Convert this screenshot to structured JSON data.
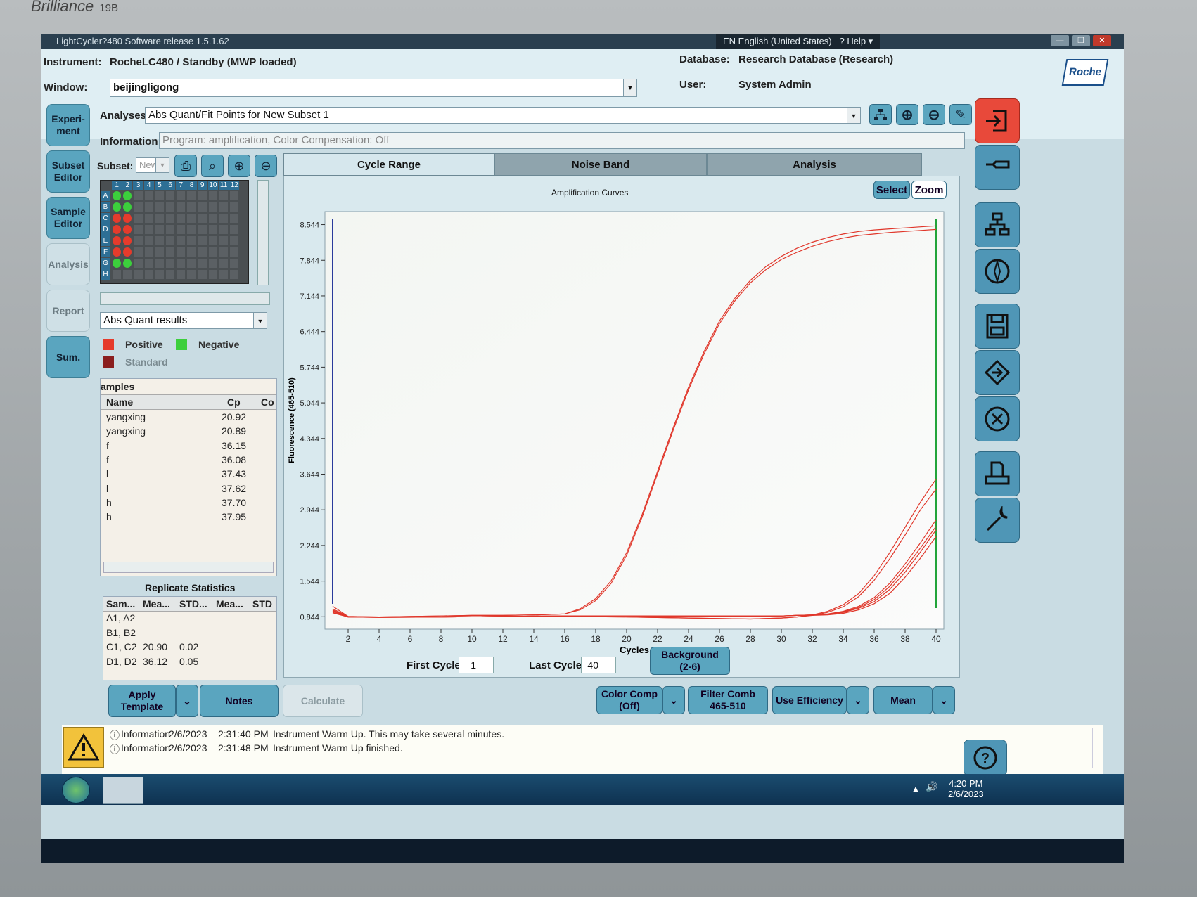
{
  "monitor": {
    "brand": "Brilliance",
    "model": "19B"
  },
  "app": {
    "title": "LightCycler?480 Software release 1.5.1.62",
    "language": "EN English (United States)",
    "help_label": "Help"
  },
  "header": {
    "instrument_label": "Instrument:",
    "instrument_value": "RocheLC480 / Standby (MWP loaded)",
    "window_label": "Window:",
    "window_value": "beijingligong",
    "database_label": "Database:",
    "database_value": "Research Database (Research)",
    "user_label": "User:",
    "user_value": "System Admin",
    "logo": "Roche"
  },
  "left_nav": [
    {
      "label": "Experi-\nment",
      "state": "active"
    },
    {
      "label": "Subset\nEditor",
      "state": "active"
    },
    {
      "label": "Sample\nEditor",
      "state": "active"
    },
    {
      "label": "Analysis",
      "state": "disabled"
    },
    {
      "label": "Report",
      "state": "disabled"
    },
    {
      "label": "Sum.",
      "state": "active"
    }
  ],
  "analyses": {
    "label": "Analyses",
    "value": "Abs Quant/Fit Points for New Subset 1",
    "info_label": "Information",
    "info_value": "Program: amplification, Color Compensation: Off"
  },
  "subset": {
    "label": "Subset:",
    "value": "New",
    "columns": [
      "1",
      "2",
      "3",
      "4",
      "5",
      "6",
      "7",
      "8",
      "9",
      "10",
      "11",
      "12"
    ],
    "rows": [
      "A",
      "B",
      "C",
      "D",
      "E",
      "F",
      "G",
      "H"
    ],
    "wells": {
      "A": [
        "green",
        "green"
      ],
      "B": [
        "green",
        "green"
      ],
      "C": [
        "red",
        "red"
      ],
      "D": [
        "red",
        "red"
      ],
      "E": [
        "red",
        "red"
      ],
      "F": [
        "red",
        "red"
      ],
      "G": [
        "green",
        "green"
      ]
    }
  },
  "results_combo": "Abs Quant results",
  "legend": {
    "positive": "Positive",
    "negative": "Negative",
    "standard": "Standard"
  },
  "colors": {
    "positive": "#e53b2c",
    "negative": "#3ccf3c",
    "standard": "#8a1e1e",
    "curve": "#e0362a",
    "threshold_left": "#2a3b9c",
    "threshold_right": "#22a43a"
  },
  "samples_table": {
    "title": "amples",
    "headers": [
      "Name",
      "Cp",
      "Co"
    ],
    "rows": [
      {
        "name": "yangxing",
        "cp": "20.92"
      },
      {
        "name": "yangxing",
        "cp": "20.89"
      },
      {
        "name": "f",
        "cp": "36.15"
      },
      {
        "name": "f",
        "cp": "36.08"
      },
      {
        "name": "l",
        "cp": "37.43"
      },
      {
        "name": "l",
        "cp": "37.62"
      },
      {
        "name": "h",
        "cp": "37.70"
      },
      {
        "name": "h",
        "cp": "37.95"
      }
    ]
  },
  "replicate_stats": {
    "title": "Replicate Statistics",
    "headers": [
      "Sam...",
      "Mea...",
      "STD...",
      "Mea...",
      "STD"
    ],
    "rows": [
      {
        "sample": "A1, A2",
        "mean": "",
        "std": ""
      },
      {
        "sample": "B1, B2",
        "mean": "",
        "std": ""
      },
      {
        "sample": "C1, C2",
        "mean": "20.90",
        "std": "0.02"
      },
      {
        "sample": "D1, D2",
        "mean": "36.12",
        "std": "0.05"
      }
    ]
  },
  "tabs": [
    "Cycle Range",
    "Noise Band",
    "Analysis"
  ],
  "chart_buttons": {
    "select": "Select",
    "zoom": "Zoom"
  },
  "chart_data": {
    "type": "line",
    "title": "Amplification Curves",
    "xlabel": "Cycles",
    "ylabel": "Fluorescence (465-510)",
    "xlim": [
      0.5,
      40.5
    ],
    "ylim": [
      0.6,
      8.8
    ],
    "xticks": [
      2,
      4,
      6,
      8,
      10,
      12,
      14,
      16,
      18,
      20,
      22,
      24,
      26,
      28,
      30,
      32,
      34,
      36,
      38,
      40
    ],
    "yticks": [
      "0.844",
      "1.544",
      "2.244",
      "2.944",
      "3.644",
      "4.344",
      "5.044",
      "5.744",
      "6.444",
      "7.144",
      "7.844",
      "8.544"
    ],
    "threshold_lines": {
      "left_x": 1,
      "right_x": 40
    },
    "series": [
      {
        "x": [
          1,
          2,
          4,
          6,
          8,
          10,
          12,
          14,
          16,
          17,
          18,
          19,
          20,
          21,
          22,
          23,
          24,
          25,
          26,
          27,
          28,
          29,
          30,
          31,
          32,
          33,
          34,
          35,
          36,
          37,
          38,
          39,
          40
        ],
        "values": [
          1.05,
          0.85,
          0.84,
          0.85,
          0.86,
          0.87,
          0.87,
          0.88,
          0.9,
          1.0,
          1.2,
          1.55,
          2.1,
          2.85,
          3.7,
          4.55,
          5.35,
          6.05,
          6.65,
          7.1,
          7.45,
          7.72,
          7.92,
          8.08,
          8.2,
          8.29,
          8.36,
          8.41,
          8.44,
          8.46,
          8.48,
          8.5,
          8.52
        ]
      },
      {
        "x": [
          1,
          2,
          4,
          6,
          8,
          10,
          12,
          14,
          16,
          17,
          18,
          19,
          20,
          21,
          22,
          23,
          24,
          25,
          26,
          27,
          28,
          29,
          30,
          31,
          32,
          33,
          34,
          35,
          36,
          37,
          38,
          39,
          40
        ],
        "values": [
          1.0,
          0.85,
          0.84,
          0.85,
          0.86,
          0.87,
          0.87,
          0.88,
          0.9,
          0.98,
          1.16,
          1.5,
          2.05,
          2.8,
          3.65,
          4.5,
          5.3,
          6.0,
          6.6,
          7.05,
          7.4,
          7.66,
          7.86,
          8.0,
          8.12,
          8.21,
          8.28,
          8.33,
          8.36,
          8.39,
          8.41,
          8.43,
          8.45
        ]
      },
      {
        "x": [
          1,
          2,
          4,
          8,
          12,
          16,
          20,
          24,
          28,
          30,
          31,
          32,
          33,
          34,
          35,
          36,
          37,
          38,
          39,
          40
        ],
        "values": [
          0.95,
          0.84,
          0.83,
          0.84,
          0.85,
          0.85,
          0.84,
          0.82,
          0.8,
          0.82,
          0.84,
          0.88,
          0.95,
          1.08,
          1.3,
          1.65,
          2.1,
          2.6,
          3.1,
          3.55
        ]
      },
      {
        "x": [
          1,
          2,
          4,
          8,
          12,
          16,
          20,
          24,
          28,
          30,
          31,
          32,
          33,
          34,
          35,
          36,
          37,
          38,
          39,
          40
        ],
        "values": [
          0.98,
          0.84,
          0.83,
          0.84,
          0.85,
          0.85,
          0.84,
          0.82,
          0.8,
          0.82,
          0.84,
          0.87,
          0.93,
          1.04,
          1.24,
          1.56,
          1.98,
          2.45,
          2.95,
          3.35
        ]
      },
      {
        "x": [
          1,
          2,
          4,
          8,
          12,
          16,
          20,
          24,
          28,
          30,
          31,
          32,
          33,
          34,
          35,
          36,
          37,
          38,
          39,
          40
        ],
        "values": [
          0.92,
          0.84,
          0.84,
          0.84,
          0.85,
          0.86,
          0.86,
          0.85,
          0.85,
          0.86,
          0.87,
          0.88,
          0.9,
          0.95,
          1.05,
          1.22,
          1.5,
          1.88,
          2.3,
          2.75
        ]
      },
      {
        "x": [
          1,
          2,
          4,
          8,
          12,
          16,
          20,
          24,
          28,
          30,
          31,
          32,
          33,
          34,
          35,
          36,
          37,
          38,
          39,
          40
        ],
        "values": [
          0.93,
          0.84,
          0.84,
          0.84,
          0.85,
          0.86,
          0.86,
          0.85,
          0.85,
          0.86,
          0.87,
          0.88,
          0.9,
          0.94,
          1.03,
          1.18,
          1.44,
          1.8,
          2.2,
          2.62
        ]
      },
      {
        "x": [
          1,
          2,
          4,
          8,
          12,
          16,
          20,
          24,
          28,
          30,
          31,
          32,
          33,
          34,
          35,
          36,
          37,
          38,
          39,
          40
        ],
        "values": [
          0.97,
          0.84,
          0.84,
          0.84,
          0.85,
          0.86,
          0.86,
          0.86,
          0.86,
          0.86,
          0.87,
          0.88,
          0.89,
          0.93,
          1.01,
          1.14,
          1.38,
          1.72,
          2.12,
          2.55
        ]
      },
      {
        "x": [
          1,
          2,
          4,
          8,
          12,
          16,
          20,
          24,
          28,
          30,
          31,
          32,
          33,
          34,
          35,
          36,
          37,
          38,
          39,
          40
        ],
        "values": [
          0.96,
          0.84,
          0.84,
          0.84,
          0.85,
          0.86,
          0.86,
          0.86,
          0.86,
          0.86,
          0.87,
          0.87,
          0.88,
          0.91,
          0.98,
          1.1,
          1.3,
          1.62,
          2.0,
          2.42
        ]
      }
    ]
  },
  "cycle_controls": {
    "first_label": "First Cycle",
    "first_value": "1",
    "last_label": "Last Cycle",
    "last_value": "40",
    "background_label": "Background\n(2-6)"
  },
  "bottom_buttons": {
    "apply_template": "Apply\nTemplate",
    "notes": "Notes",
    "calculate": "Calculate",
    "color_comp": "Color Comp\n(Off)",
    "filter_comb": "Filter Comb\n465-510",
    "use_efficiency": "Use Efficiency",
    "mean": "Mean"
  },
  "messages": [
    {
      "type": "Information",
      "date": "2/6/2023",
      "time": "2:31:40 PM",
      "text": "Instrument Warm Up. This may take several minutes."
    },
    {
      "type": "Information",
      "date": "2/6/2023",
      "time": "2:31:48 PM",
      "text": "Instrument Warm Up finished."
    }
  ],
  "taskbar": {
    "time": "4:20 PM",
    "date": "2/6/2023"
  }
}
